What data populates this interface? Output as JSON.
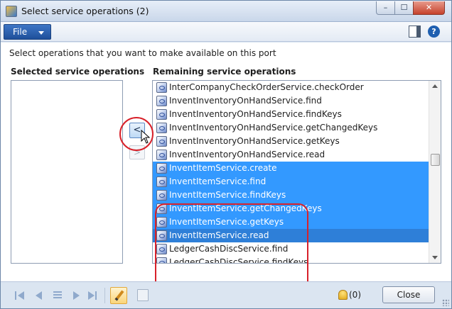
{
  "window": {
    "title": "Select service operations (2)",
    "controls": {
      "minimize": "–",
      "maximize": "☐",
      "close": "✕"
    }
  },
  "menubar": {
    "file_label": "File",
    "icons": [
      "layout-icon",
      "help-icon"
    ],
    "help_glyph": "?"
  },
  "instructions": "Select operations that you want to make available on this port",
  "selected_panel": {
    "header": "Selected service operations",
    "items": []
  },
  "remaining_panel": {
    "header": "Remaining service operations",
    "items": [
      {
        "label": "InterCompanyCheckOrderService.checkOrder",
        "selected": false
      },
      {
        "label": "InventInventoryOnHandService.find",
        "selected": false
      },
      {
        "label": "InventInventoryOnHandService.findKeys",
        "selected": false
      },
      {
        "label": "InventInventoryOnHandService.getChangedKeys",
        "selected": false
      },
      {
        "label": "InventInventoryOnHandService.getKeys",
        "selected": false
      },
      {
        "label": "InventInventoryOnHandService.read",
        "selected": false
      },
      {
        "label": "InventItemService.create",
        "selected": true
      },
      {
        "label": "InventItemService.find",
        "selected": true
      },
      {
        "label": "InventItemService.findKeys",
        "selected": true
      },
      {
        "label": "InventItemService.getChangedKeys",
        "selected": true
      },
      {
        "label": "InventItemService.getKeys",
        "selected": true
      },
      {
        "label": "InventItemService.read",
        "selected": true
      },
      {
        "label": "LedgerCashDiscService.find",
        "selected": false
      },
      {
        "label": "LedgerCashDiscService.findKeys",
        "selected": false
      }
    ]
  },
  "transfer": {
    "move_left": "<",
    "move_right": ">"
  },
  "footer": {
    "nav_icons": [
      "first-record-icon",
      "previous-record-icon",
      "grid-icon",
      "next-record-icon",
      "last-record-icon"
    ],
    "notification_count": "(0)",
    "close_label": "Close"
  },
  "colors": {
    "selection": "#3399ff",
    "annotation_red": "#d8212a",
    "file_button": "#2a5fae"
  }
}
